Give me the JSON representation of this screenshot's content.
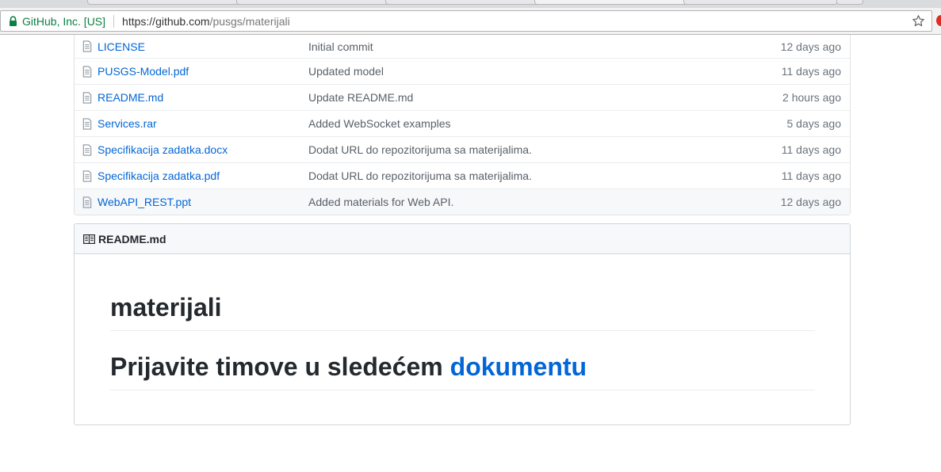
{
  "browser": {
    "site_identity": "GitHub, Inc. [US]",
    "url_host": "https://github.com",
    "url_path": "/pusgs/materijali"
  },
  "files": [
    {
      "name": "LICENSE",
      "message": "Initial commit",
      "age": "12 days ago"
    },
    {
      "name": "PUSGS-Model.pdf",
      "message": "Updated model",
      "age": "11 days ago"
    },
    {
      "name": "README.md",
      "message": "Update README.md",
      "age": "2 hours ago"
    },
    {
      "name": "Services.rar",
      "message": "Added WebSocket examples",
      "age": "5 days ago"
    },
    {
      "name": "Specifikacija zadatka.docx",
      "message": "Dodat URL do repozitorijuma sa materijalima.",
      "age": "11 days ago"
    },
    {
      "name": "Specifikacija zadatka.pdf",
      "message": "Dodat URL do repozitorijuma sa materijalima.",
      "age": "11 days ago"
    },
    {
      "name": "WebAPI_REST.ppt",
      "message": "Added materials for Web API.",
      "age": "12 days ago"
    }
  ],
  "readme": {
    "header_label": "README.md",
    "heading": "materijali",
    "subheading_text": "Prijavite timove u sledećem ",
    "subheading_link": "dokumentu"
  },
  "colors": {
    "link": "#0366d6",
    "secure": "#0b8043"
  },
  "icons": {
    "file": "file-icon",
    "book": "book-icon",
    "lock": "lock-icon",
    "star": "star-icon"
  }
}
